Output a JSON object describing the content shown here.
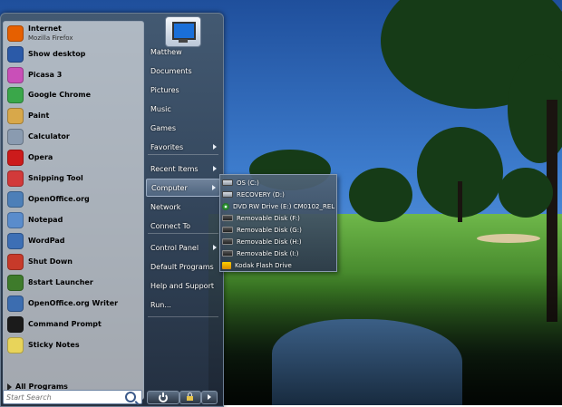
{
  "start_menu": {
    "programs": [
      {
        "name": "Internet",
        "sub": "Mozilla Firefox",
        "icon": "firefox-icon",
        "color": "#e66000"
      },
      {
        "name": "Show desktop",
        "sub": "",
        "icon": "show-desktop-icon",
        "color": "#2b5aa8"
      },
      {
        "name": "Picasa 3",
        "sub": "",
        "icon": "picasa-icon",
        "color": "#c94fb8"
      },
      {
        "name": "Google Chrome",
        "sub": "",
        "icon": "chrome-icon",
        "color": "#3aa74a"
      },
      {
        "name": "Paint",
        "sub": "",
        "icon": "paint-icon",
        "color": "#d8a84a"
      },
      {
        "name": "Calculator",
        "sub": "",
        "icon": "calculator-icon",
        "color": "#8a9bb0"
      },
      {
        "name": "Opera",
        "sub": "",
        "icon": "opera-icon",
        "color": "#cc1b1b"
      },
      {
        "name": "Snipping Tool",
        "sub": "",
        "icon": "snipping-tool-icon",
        "color": "#d23a3a"
      },
      {
        "name": "OpenOffice.org",
        "sub": "",
        "icon": "openoffice-icon",
        "color": "#4d7fb8"
      },
      {
        "name": "Notepad",
        "sub": "",
        "icon": "notepad-icon",
        "color": "#5a8ccc"
      },
      {
        "name": "WordPad",
        "sub": "",
        "icon": "wordpad-icon",
        "color": "#3d6fb5"
      },
      {
        "name": "Shut Down",
        "sub": "",
        "icon": "shut-down-icon",
        "color": "#c73a2a"
      },
      {
        "name": "8start Launcher",
        "sub": "",
        "icon": "8start-launcher-icon",
        "color": "#3e7b2b"
      },
      {
        "name": "OpenOffice.org Writer",
        "sub": "",
        "icon": "openoffice-writer-icon",
        "color": "#3c6db0"
      },
      {
        "name": "Command Prompt",
        "sub": "",
        "icon": "command-prompt-icon",
        "color": "#1b1b1b"
      },
      {
        "name": "Sticky Notes",
        "sub": "",
        "icon": "sticky-notes-icon",
        "color": "#e8d45a"
      }
    ],
    "all_programs": "All Programs",
    "search_placeholder": "Start Search",
    "right_items": [
      {
        "label": "Matthew",
        "submenu": false
      },
      {
        "label": "Documents",
        "submenu": false
      },
      {
        "label": "Pictures",
        "submenu": false
      },
      {
        "label": "Music",
        "submenu": false
      },
      {
        "label": "Games",
        "submenu": false
      },
      {
        "label": "Favorites",
        "submenu": true
      },
      {
        "label": "Recent Items",
        "submenu": true
      },
      {
        "label": "Computer",
        "submenu": true,
        "highlighted": true
      },
      {
        "label": "Network",
        "submenu": false
      },
      {
        "label": "Connect To",
        "submenu": false
      },
      {
        "label": "Control Panel",
        "submenu": true
      },
      {
        "label": "Default Programs",
        "submenu": false
      },
      {
        "label": "Help and Support",
        "submenu": false
      },
      {
        "label": "Run...",
        "submenu": false
      }
    ]
  },
  "computer_submenu": [
    {
      "label": "OS (C:)",
      "icon": "hard-disk-icon"
    },
    {
      "label": "RECOVERY (D:)",
      "icon": "hard-disk-icon"
    },
    {
      "label": "DVD RW Drive (E:) CM0102_REL",
      "icon": "dvd-drive-icon"
    },
    {
      "label": "Removable Disk (F:)",
      "icon": "removable-disk-icon"
    },
    {
      "label": "Removable Disk (G:)",
      "icon": "removable-disk-icon"
    },
    {
      "label": "Removable Disk (H:)",
      "icon": "removable-disk-icon"
    },
    {
      "label": "Removable Disk (I:)",
      "icon": "removable-disk-icon"
    },
    {
      "label": "Kodak Flash Drive",
      "icon": "kodak-flash-drive-icon"
    }
  ],
  "colors": {
    "accent": "#3c5a8a",
    "menu_dark": "#2c3644"
  }
}
